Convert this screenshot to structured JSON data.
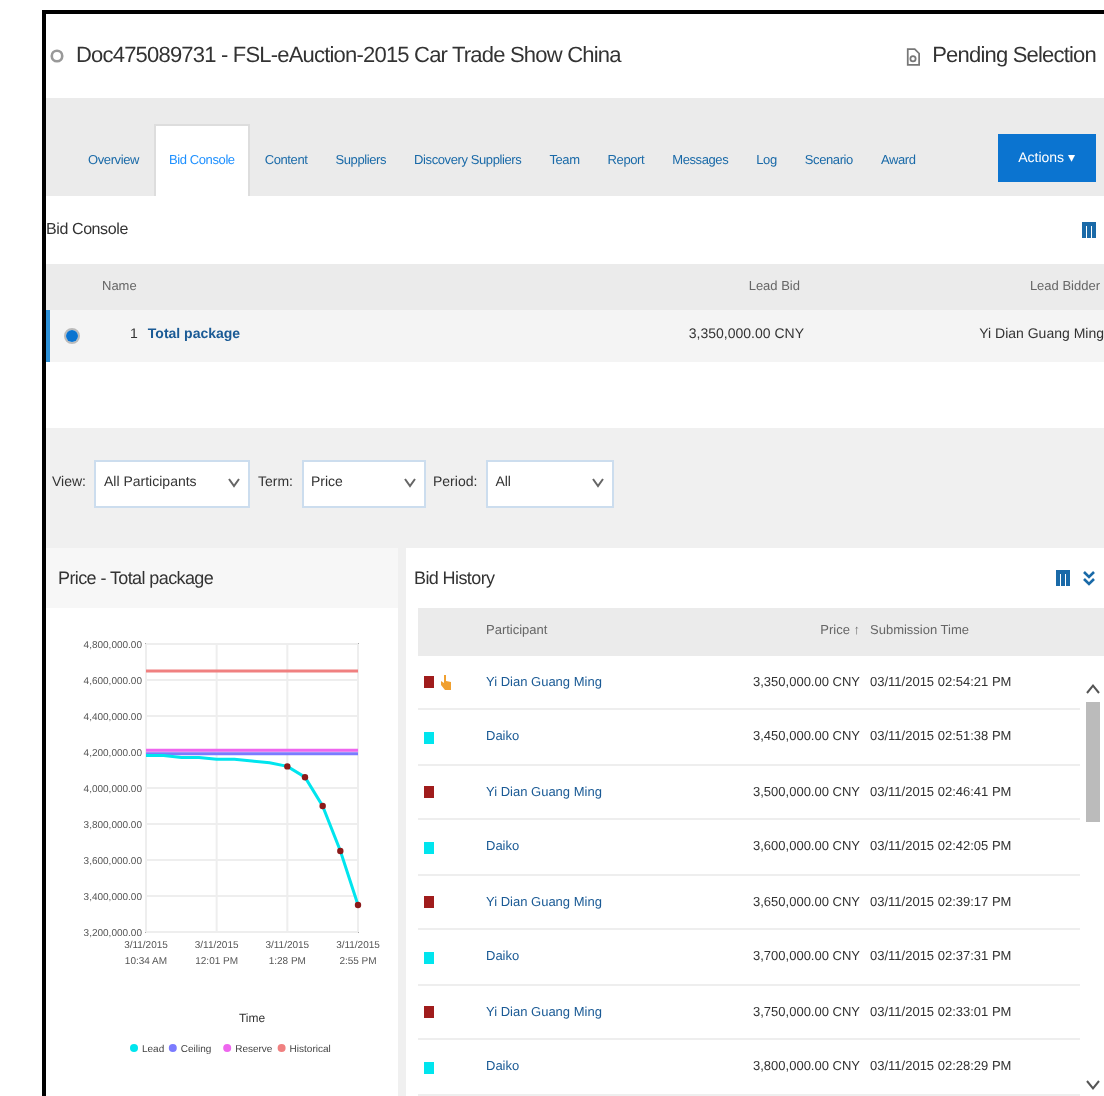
{
  "window": {
    "title": "Doc475089731 - FSL-eAuction-2015 Car Trade Show China",
    "status": "Pending Selection"
  },
  "tabs": [
    {
      "label": "Overview",
      "selected": false
    },
    {
      "label": "Bid Console",
      "selected": true
    },
    {
      "label": "Content",
      "selected": false
    },
    {
      "label": "Suppliers",
      "selected": false
    },
    {
      "label": "Discovery Suppliers",
      "selected": false
    },
    {
      "label": "Team",
      "selected": false
    },
    {
      "label": "Report",
      "selected": false
    },
    {
      "label": "Messages",
      "selected": false
    },
    {
      "label": "Log",
      "selected": false
    },
    {
      "label": "Scenario",
      "selected": false
    },
    {
      "label": "Award",
      "selected": false
    }
  ],
  "actions_button": "Actions ▾",
  "bid_console": {
    "title": "Bid Console",
    "columns": [
      "Name",
      "Lead Bid",
      "Lead Bidder"
    ],
    "rows": [
      {
        "selected": true,
        "number": "1",
        "name": "Total package",
        "lead_bid": "3,350,000.00 CNY",
        "lead_bidder": "Yi Dian Guang Ming"
      }
    ]
  },
  "filters": [
    {
      "label": "View:",
      "value": "All Participants"
    },
    {
      "label": "Term:",
      "value": "Price"
    },
    {
      "label": "Period:",
      "value": "All"
    }
  ],
  "chart_panel": {
    "title": "Price - Total package",
    "chart_data": {
      "type": "line",
      "xlabel": "Time",
      "categories": [
        "3/11/2015 10:34 AM",
        null,
        null,
        null,
        "3/11/2015 12:01 PM",
        null,
        null,
        null,
        "3/11/2015 1:28 PM",
        null,
        null,
        null,
        "3/11/2015 2:55 PM"
      ],
      "ylim": [
        3200000,
        4800000
      ],
      "grid": true,
      "legend": true,
      "yticks": [
        {
          "value": 3200000,
          "label": "3,200,000.00"
        },
        {
          "value": 3400000,
          "label": "3,400,000.00"
        },
        {
          "value": 3600000,
          "label": "3,600,000.00"
        },
        {
          "value": 3800000,
          "label": "3,800,000.00"
        },
        {
          "value": 4000000,
          "label": "4,000,000.00"
        },
        {
          "value": 4200000,
          "label": "4,200,000.00"
        },
        {
          "value": 4400000,
          "label": "4,400,000.00"
        },
        {
          "value": 4600000,
          "label": "4,600,000.00"
        },
        {
          "value": 4800000,
          "label": "4,800,000.00"
        }
      ],
      "series": [
        {
          "name": "Lead",
          "color": "#00e5ee",
          "values": [
            4180000,
            4180000,
            4170000,
            4170000,
            4160000,
            4160000,
            4150000,
            4140000,
            4120000,
            4060000,
            3900000,
            3650000,
            3350000
          ]
        },
        {
          "name": "Ceiling",
          "color": "#7b7bff",
          "values": [
            4190000,
            4190000,
            4190000,
            4190000,
            4190000,
            4190000,
            4190000,
            4190000,
            4190000,
            4190000,
            4190000,
            4190000,
            4190000
          ]
        },
        {
          "name": "Reserve",
          "color": "#ee66ee",
          "values": [
            4210000,
            4210000,
            4210000,
            4210000,
            4210000,
            4210000,
            4210000,
            4210000,
            4210000,
            4210000,
            4210000,
            4210000,
            4210000
          ]
        },
        {
          "name": "Historical",
          "color": "#f08080",
          "values": [
            4650000,
            4650000,
            4650000,
            4650000,
            4650000,
            4650000,
            4650000,
            4650000,
            4650000,
            4650000,
            4650000,
            4650000,
            4650000
          ]
        }
      ]
    }
  },
  "bid_history": {
    "title": "Bid History",
    "columns": [
      "Participant",
      "Price ↑",
      "Submission Time"
    ],
    "rows": [
      {
        "color": "#a01c1c",
        "leading": true,
        "participant": "Yi Dian Guang Ming",
        "price": "3,350,000.00 CNY",
        "time": "03/11/2015 02:54:21 PM"
      },
      {
        "color": "#00e5ee",
        "leading": false,
        "participant": "Daiko",
        "price": "3,450,000.00 CNY",
        "time": "03/11/2015 02:51:38 PM"
      },
      {
        "color": "#a01c1c",
        "leading": false,
        "participant": "Yi Dian Guang Ming",
        "price": "3,500,000.00 CNY",
        "time": "03/11/2015 02:46:41 PM"
      },
      {
        "color": "#00e5ee",
        "leading": false,
        "participant": "Daiko",
        "price": "3,600,000.00 CNY",
        "time": "03/11/2015 02:42:05 PM"
      },
      {
        "color": "#a01c1c",
        "leading": false,
        "participant": "Yi Dian Guang Ming",
        "price": "3,650,000.00 CNY",
        "time": "03/11/2015 02:39:17 PM"
      },
      {
        "color": "#00e5ee",
        "leading": false,
        "participant": "Daiko",
        "price": "3,700,000.00 CNY",
        "time": "03/11/2015 02:37:31 PM"
      },
      {
        "color": "#a01c1c",
        "leading": false,
        "participant": "Yi Dian Guang Ming",
        "price": "3,750,000.00 CNY",
        "time": "03/11/2015 02:33:01 PM"
      },
      {
        "color": "#00e5ee",
        "leading": false,
        "participant": "Daiko",
        "price": "3,800,000.00 CNY",
        "time": "03/11/2015 02:28:29 PM"
      }
    ]
  }
}
